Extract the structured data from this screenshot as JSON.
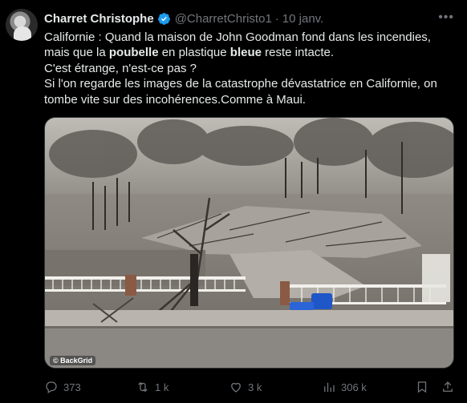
{
  "author": {
    "name": "Charret Christophe",
    "handle": "@CharretChristo1",
    "separator": "·",
    "date": "10 janv."
  },
  "tweet": {
    "line1": "Californie : Quand la maison de John Goodman fond dans les incendies,",
    "line2_a": "mais que la ",
    "line2_b": "poubelle",
    "line2_c": " en plastique ",
    "line2_d": "bleue",
    "line2_e": " reste intacte.",
    "line3": "C'est étrange, n'est-ce pas ?",
    "line4": "Si l'on regarde les images de la catastrophe dévastatrice en Californie, on",
    "line5": "tombe vite sur des incohérences.Comme à Maui."
  },
  "media": {
    "watermark": "© BackGrid"
  },
  "stats": {
    "replies": "373",
    "retweets": "1 k",
    "likes": "3 k",
    "views": "306 k"
  },
  "icons": [
    "verified-icon",
    "more-icon",
    "reply-icon",
    "retweet-icon",
    "like-icon",
    "views-icon",
    "bookmark-icon",
    "share-icon"
  ],
  "colors": {
    "verified": "#1d9bf0",
    "muted": "#71767b",
    "text": "#e7e9ea"
  }
}
